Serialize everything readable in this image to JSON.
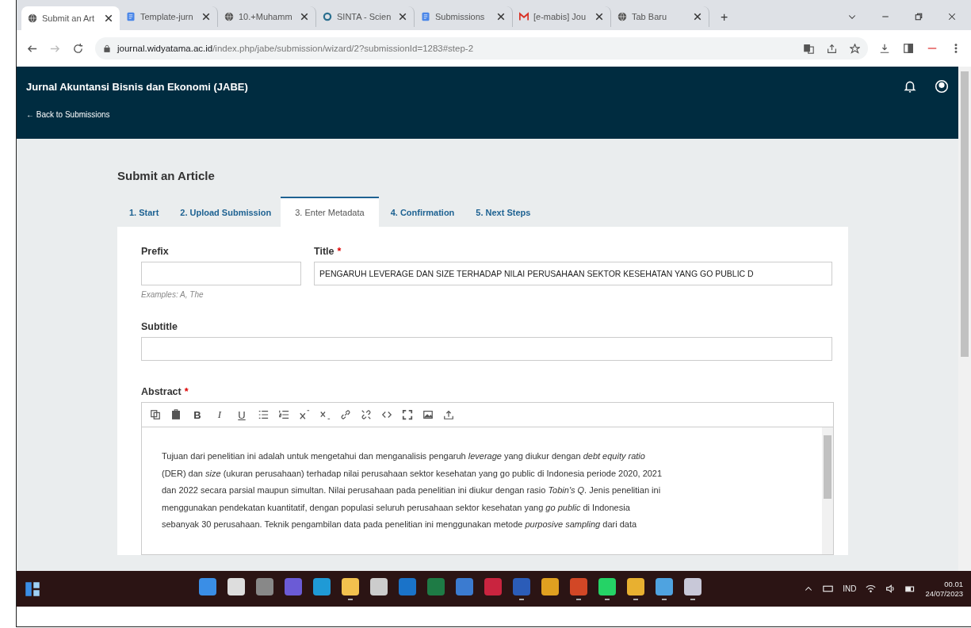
{
  "browser": {
    "tabs": [
      {
        "title": "Submit an Art",
        "kind": "globe",
        "selected": true
      },
      {
        "title": "Template-jurn",
        "kind": "doc",
        "selected": false
      },
      {
        "title": "10.+Muhamm",
        "kind": "globe",
        "selected": false
      },
      {
        "title": "SINTA - Scien",
        "kind": "ring",
        "selected": false
      },
      {
        "title": "Submissions",
        "kind": "doc",
        "selected": false
      },
      {
        "title": "[e-mabis] Jou",
        "kind": "mail",
        "selected": false
      },
      {
        "title": "Tab Baru",
        "kind": "globe",
        "selected": false
      }
    ],
    "new_tab": "+",
    "url_host": "journal.widyatama.ac.id",
    "url_path": "/index.php/jabe/submission/wizard/2?submissionId=1283#step-2"
  },
  "site": {
    "journal_title": "Jurnal Akuntansi Bisnis dan Ekonomi (JABE)",
    "back_link": "← Back to Submissions"
  },
  "page_title": "Submit an Article",
  "steps": [
    {
      "label": "1. Start",
      "selected": false
    },
    {
      "label": "2. Upload Submission",
      "selected": false
    },
    {
      "label": "3. Enter Metadata",
      "selected": true
    },
    {
      "label": "4. Confirmation",
      "selected": false
    },
    {
      "label": "5. Next Steps",
      "selected": false
    }
  ],
  "form": {
    "prefix": {
      "label": "Prefix",
      "hint": "Examples: A, The"
    },
    "title": {
      "label": "Title",
      "required_mark": "*",
      "value": "PENGARUH LEVERAGE DAN SIZE TERHADAP NILAI PERUSAHAAN SEKTOR KESEHATAN YANG GO PUBLIC D"
    },
    "subtitle": {
      "label": "Subtitle"
    },
    "abstract": {
      "label": "Abstract",
      "required_mark": "*",
      "toolbar": [
        {
          "kind": "copy"
        },
        {
          "kind": "paste"
        },
        {
          "kind": "bold",
          "label": "B"
        },
        {
          "kind": "italic",
          "label": "I"
        },
        {
          "kind": "underline",
          "label": "U"
        },
        {
          "kind": "bullets"
        },
        {
          "kind": "numbers"
        },
        {
          "kind": "sup"
        },
        {
          "kind": "sub"
        },
        {
          "kind": "link"
        },
        {
          "kind": "unlink"
        },
        {
          "kind": "code"
        },
        {
          "kind": "fullscreen"
        },
        {
          "kind": "image"
        },
        {
          "kind": "upload"
        }
      ],
      "lines": [
        "Tujuan dari penelitian ini adalah untuk mengetahui dan menganalisis pengaruh *leverage* yang diukur dengan *debt equity ratio*",
        "(DER) dan *size* (ukuran perusahaan) terhadap nilai perusahaan sektor kesehatan yang go public di Indonesia periode 2020, 2021",
        "dan 2022 secara parsial maupun simultan. Nilai perusahaan pada penelitian ini diukur dengan rasio *Tobin's Q*. Jenis penelitian ini",
        "menggunakan pendekatan kuantitatif, dengan populasi seluruh perusahaan sektor kesehatan yang *go public* di Indonesia",
        "sebanyak 30 perusahaan. Teknik pengambilan data pada penelitian ini menggunakan metode *purposive sampling* dari data"
      ]
    }
  },
  "taskbar": {
    "apps": [
      {
        "color": "#3a8ee6",
        "active": false
      },
      {
        "color": "#dddddd",
        "active": false
      },
      {
        "color": "#888888",
        "active": false
      },
      {
        "color": "#6b5bd6",
        "active": false
      },
      {
        "color": "#1f9ad6",
        "active": false
      },
      {
        "color": "#f2c14e",
        "active": true
      },
      {
        "color": "#cccccc",
        "active": false
      },
      {
        "color": "#1a73c9",
        "active": false
      },
      {
        "color": "#1e7b45",
        "active": false
      },
      {
        "color": "#3b7bd0",
        "active": false
      },
      {
        "color": "#c9243f",
        "active": false
      },
      {
        "color": "#2b5cb8",
        "active": true
      },
      {
        "color": "#e0a020",
        "active": false
      },
      {
        "color": "#d24726",
        "active": true
      },
      {
        "color": "#25d366",
        "active": true
      },
      {
        "color": "#e8b030",
        "active": true
      },
      {
        "color": "#4fa3e0",
        "active": true
      },
      {
        "color": "#c8c8d8",
        "active": true
      }
    ],
    "language": "IND",
    "time": "00.01",
    "date": "24/07/2023"
  }
}
